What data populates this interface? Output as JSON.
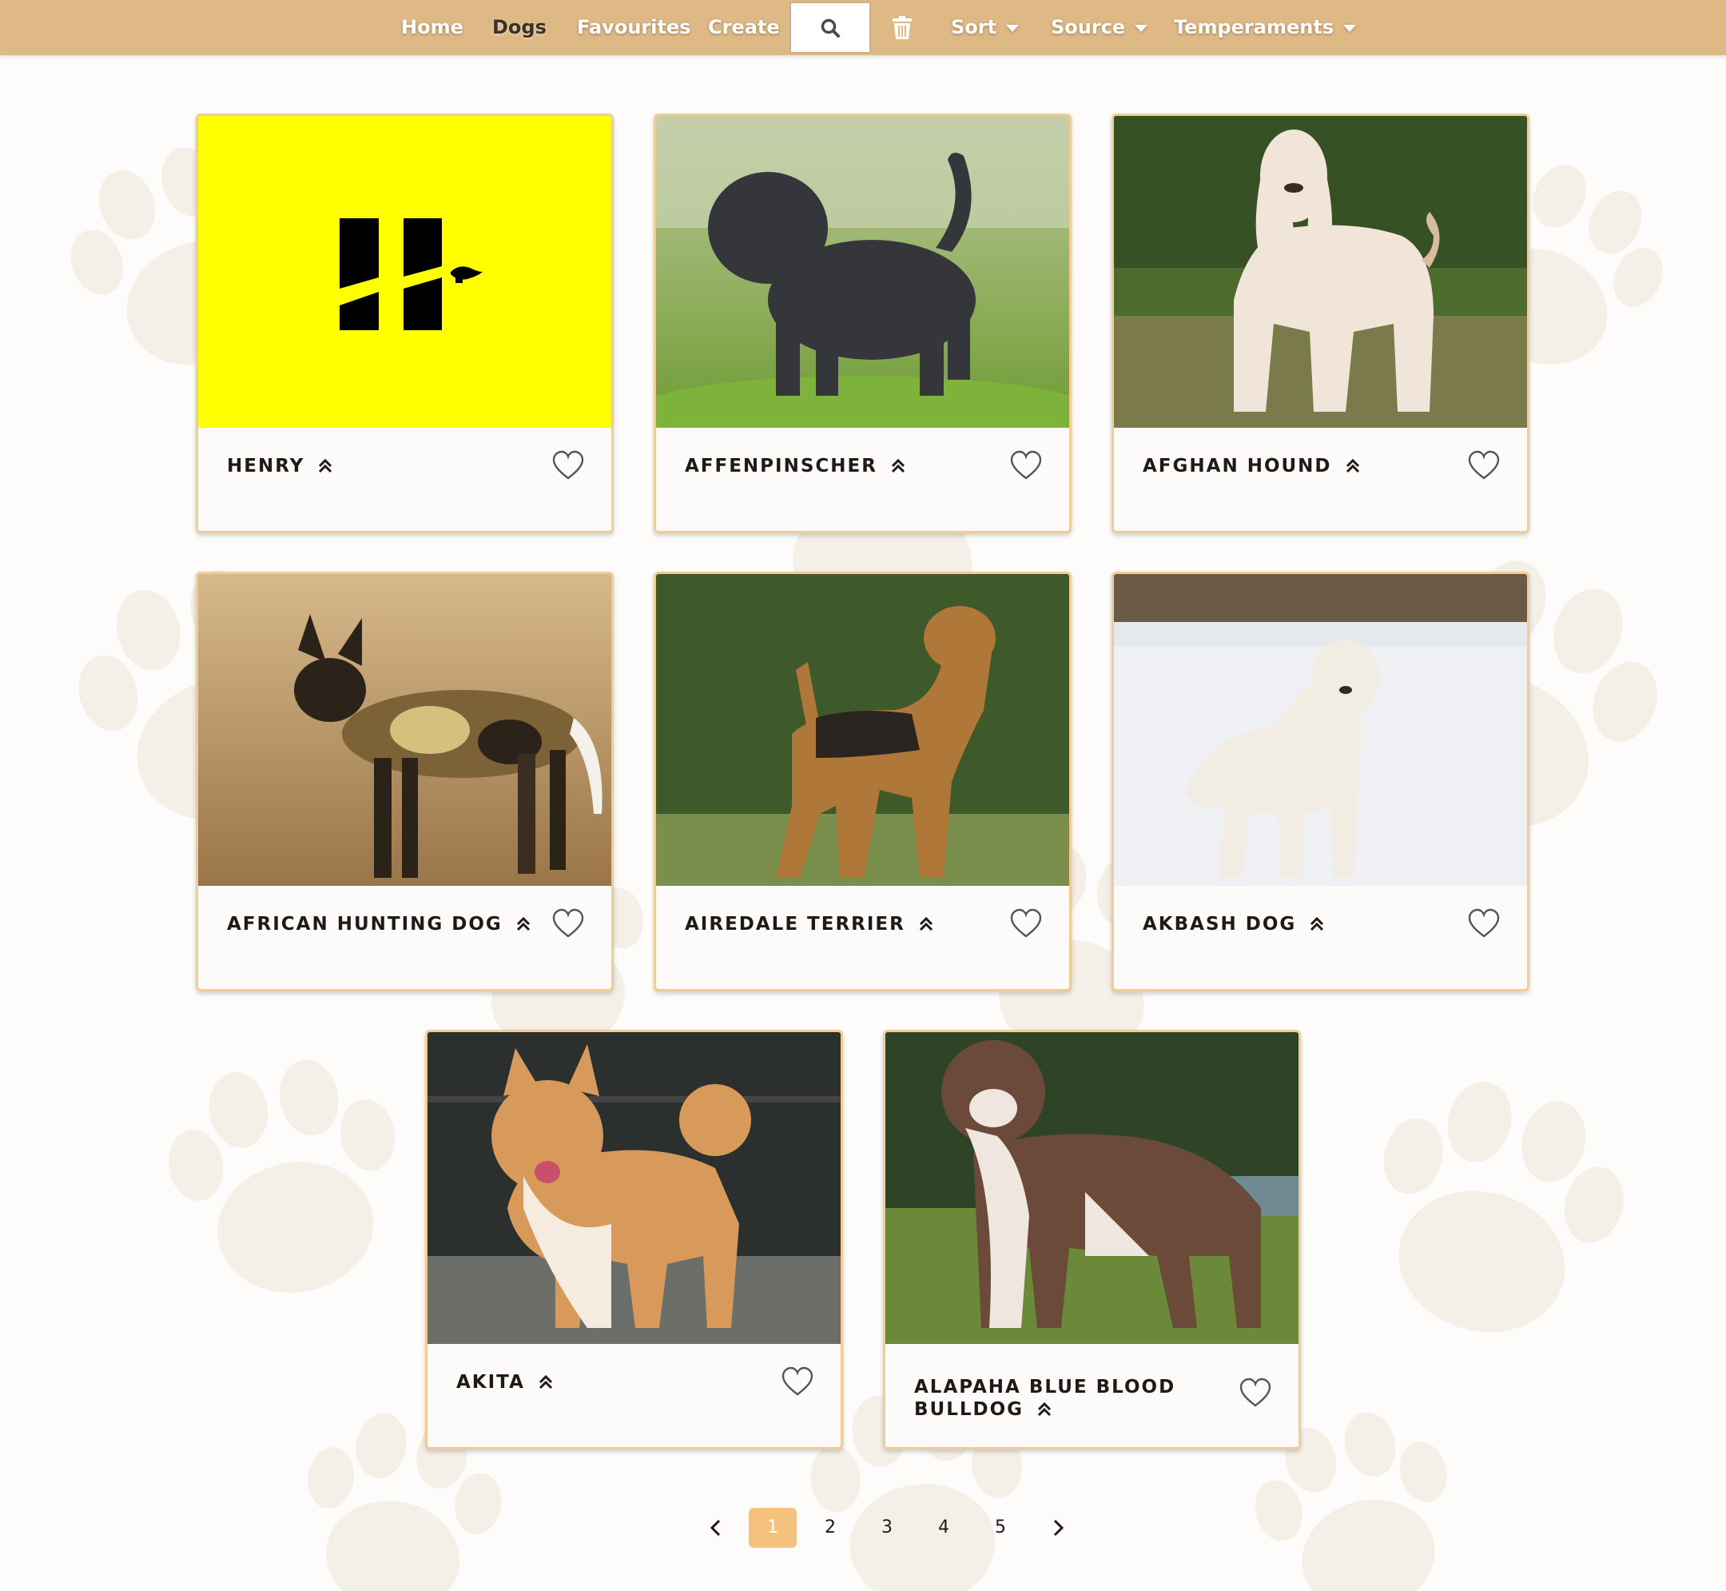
{
  "nav": {
    "home": "Home",
    "dogs": "Dogs",
    "favourites": "Favourites",
    "create": "Create",
    "sort": "Sort",
    "source": "Source",
    "temperaments": "Temperaments"
  },
  "colors": {
    "navbar": "#dfb985",
    "card_border": "#f2cc95",
    "page_current": "#f5c27d",
    "background": "#fdfcfa",
    "paw": "#f4efe7"
  },
  "cards": [
    {
      "name": "Henry",
      "image": "yellow-logo"
    },
    {
      "name": "Affenpinscher",
      "image": "dog-photo"
    },
    {
      "name": "Afghan Hound",
      "image": "dog-photo"
    },
    {
      "name": "African Hunting Dog",
      "image": "dog-photo"
    },
    {
      "name": "Airedale Terrier",
      "image": "dog-photo"
    },
    {
      "name": "Akbash Dog",
      "image": "dog-photo"
    },
    {
      "name": "Akita",
      "image": "dog-photo"
    },
    {
      "name": "Alapaha Blue Blood Bulldog",
      "image": "dog-photo"
    }
  ],
  "pagination": {
    "pages": [
      "1",
      "2",
      "3",
      "4",
      "5"
    ],
    "current": "1"
  },
  "icons": {
    "search": "search-icon",
    "trash": "trash-icon",
    "chevrons": "double-chevron-up-icon",
    "heart": "heart-outline-icon",
    "prev": "chevron-left-icon",
    "next": "chevron-right-icon"
  }
}
